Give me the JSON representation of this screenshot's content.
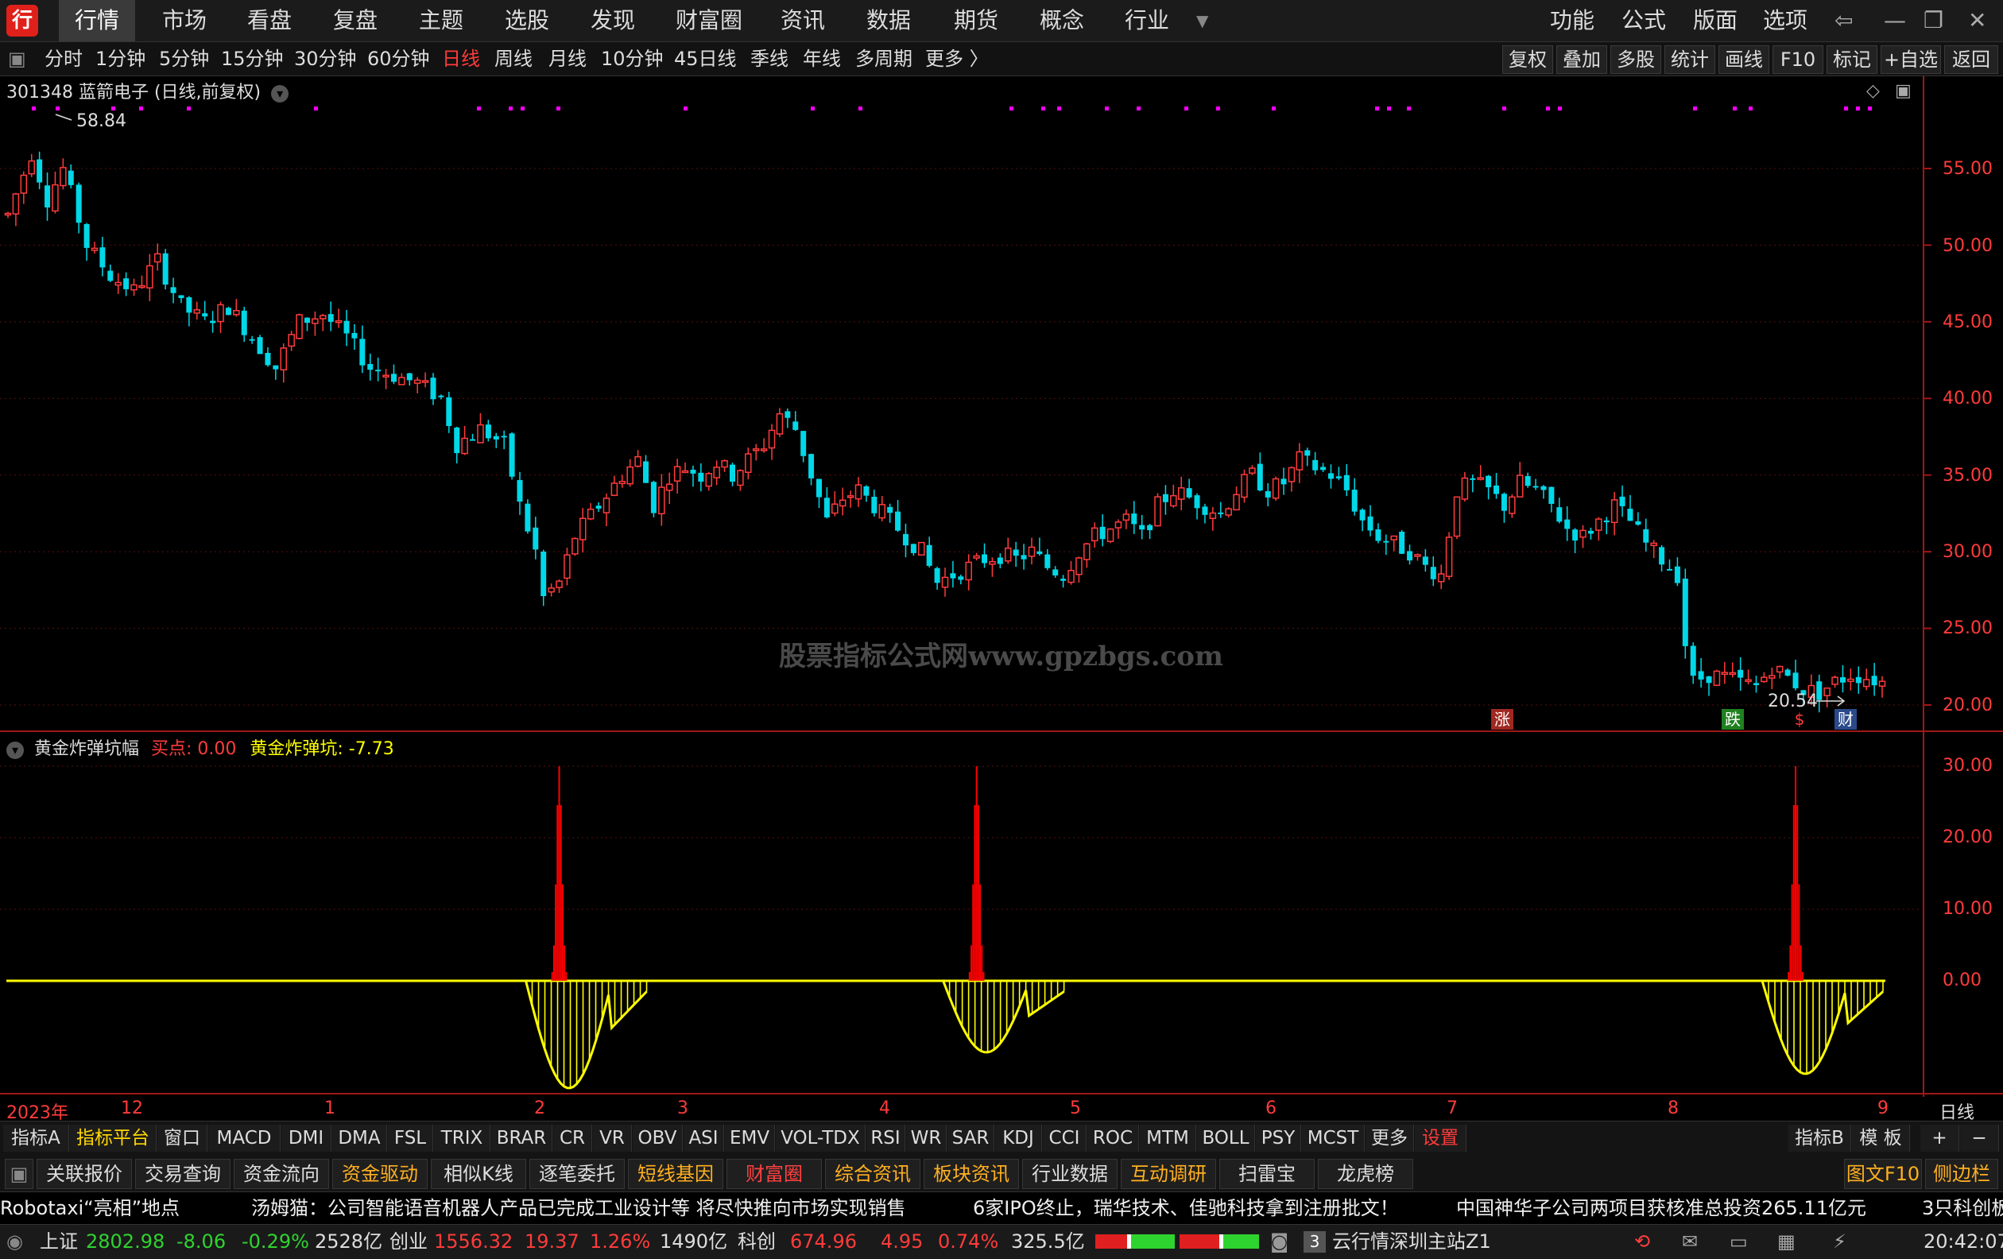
{
  "menu": {
    "logo_text": "行",
    "items": [
      "行情",
      "市场",
      "看盘",
      "复盘",
      "主题",
      "选股",
      "发现",
      "财富圈",
      "资讯",
      "数据",
      "期货",
      "概念",
      "行业"
    ],
    "more_icon": "chevron-down-icon",
    "right_items": [
      "功能",
      "公式",
      "版面",
      "选项"
    ]
  },
  "periods": {
    "items": [
      "分时",
      "1分钟",
      "5分钟",
      "15分钟",
      "30分钟",
      "60分钟",
      "日线",
      "周线",
      "月线",
      "10分钟",
      "45日线",
      "季线",
      "年线",
      "多周期",
      "更多 〉"
    ],
    "active": "日线",
    "right_buttons": [
      "复权",
      "叠加",
      "多股",
      "统计",
      "画线",
      "F10",
      "标记",
      "+自选",
      "返回"
    ]
  },
  "chart_title": "301348 蓝箭电子 (日线,前复权)",
  "price_high_label": "58.84",
  "price_low_label": "20.54",
  "watermark": "股票指标公式网www.gpzbgs.com",
  "event_markers": [
    {
      "text": "涨",
      "color": "#c0302a"
    },
    {
      "text": "跌",
      "color": "#2a8a2a"
    },
    {
      "text": "$",
      "color": "#c0302a"
    },
    {
      "text": "财",
      "color": "#3a5a9a"
    }
  ],
  "indicator": {
    "name": "黄金炸弹坑幅",
    "buy_label": "买点: 0.00",
    "pit_label": "黄金炸弹坑: -7.73"
  },
  "axis_label_period": "日线",
  "date_labels": [
    "2023年",
    "12",
    "1",
    "2",
    "3",
    "4",
    "5",
    "6",
    "7",
    "8",
    "9"
  ],
  "tabs": [
    "指标A",
    "指标平台",
    "窗口",
    "MACD",
    "DMI",
    "DMA",
    "FSL",
    "TRIX",
    "BRAR",
    "CR",
    "VR",
    "OBV",
    "ASI",
    "EMV",
    "VOL-TDX",
    "RSI",
    "WR",
    "SAR",
    "KDJ",
    "CCI",
    "ROC",
    "MTM",
    "BOLL",
    "PSY",
    "MCST",
    "更多",
    "设置"
  ],
  "tabs_right": [
    "指标B",
    "模 板",
    "+",
    "−"
  ],
  "func_buttons": [
    "关联报价",
    "交易查询",
    "资金流向",
    "资金驱动",
    "相似K线",
    "逐笔委托",
    "短线基因",
    "财富圈",
    "综合资讯",
    "板块资讯",
    "行业数据",
    "互动调研",
    "扫雷宝",
    "龙虎榜"
  ],
  "func_right": [
    "图文F10",
    "侧边栏"
  ],
  "news": [
    "Robotaxi“亮相”地点",
    "汤姆猫：公司智能语音机器人产品已完成工业设计等 将尽快推向市场实现销售",
    "6家IPO终止，瑞华技术、佳驰科技拿到注册批文！",
    "中国神华子公司两项目获核准总投资265.11亿元",
    "3只科创板"
  ],
  "status": {
    "sh_name": "上证",
    "sh_value": "2802.98",
    "sh_change": "-8.06",
    "sh_pct": "-0.29%",
    "sh_amount": "2528亿",
    "cy_name": "创业",
    "cy_value": "1556.32",
    "cy_change": "19.37",
    "cy_pct": "1.26%",
    "cy_amount": "1490亿",
    "kc_name": "科创",
    "kc_value": "674.96",
    "kc_change": "4.95",
    "kc_pct": "0.74%",
    "kc_amount": "325.5亿",
    "server": "云行情深圳主站Z1",
    "msg_count": "3",
    "time": "20:42:07"
  },
  "chart_data": {
    "type": "candlestick",
    "price_axis": {
      "min": 20.0,
      "max": 55.0,
      "ticks": [
        "55.00",
        "50.00",
        "45.00",
        "40.00",
        "35.00",
        "30.00",
        "25.00",
        "20.00"
      ]
    },
    "indicator_axis": {
      "ticks": [
        "30.00",
        "20.00",
        "10.00",
        "0.00"
      ]
    },
    "price_path": [
      [
        0,
        52
      ],
      [
        3,
        56
      ],
      [
        5,
        53
      ],
      [
        7,
        55
      ],
      [
        10,
        50
      ],
      [
        13,
        48
      ],
      [
        16,
        47
      ],
      [
        19,
        49
      ],
      [
        22,
        46
      ],
      [
        25,
        45
      ],
      [
        28,
        46
      ],
      [
        31,
        44
      ],
      [
        34,
        42
      ],
      [
        37,
        45
      ],
      [
        40,
        45.5
      ],
      [
        43,
        44
      ],
      [
        46,
        42
      ],
      [
        49,
        41.5
      ],
      [
        52,
        41
      ],
      [
        55,
        40
      ],
      [
        57,
        37
      ],
      [
        60,
        38
      ],
      [
        63,
        37
      ],
      [
        65,
        33
      ],
      [
        67,
        30
      ],
      [
        68,
        27
      ],
      [
        70,
        28
      ],
      [
        72,
        31
      ],
      [
        75,
        33
      ],
      [
        78,
        35
      ],
      [
        80,
        36
      ],
      [
        82,
        33
      ],
      [
        84,
        35
      ],
      [
        86,
        35.5
      ],
      [
        88,
        35
      ],
      [
        90,
        35.8
      ],
      [
        92,
        35
      ],
      [
        94,
        36
      ],
      [
        96,
        37
      ],
      [
        98,
        39
      ],
      [
        100,
        38
      ],
      [
        102,
        35
      ],
      [
        104,
        32
      ],
      [
        106,
        33.5
      ],
      [
        108,
        34
      ],
      [
        110,
        33
      ],
      [
        112,
        32
      ],
      [
        114,
        31
      ],
      [
        116,
        30
      ],
      [
        118,
        28
      ],
      [
        120,
        28.5
      ],
      [
        122,
        29
      ],
      [
        124,
        29.5
      ],
      [
        126,
        29.8
      ],
      [
        128,
        29.5
      ],
      [
        130,
        30
      ],
      [
        132,
        29
      ],
      [
        134,
        28.5
      ],
      [
        136,
        30
      ],
      [
        138,
        31
      ],
      [
        140,
        31.5
      ],
      [
        142,
        32
      ],
      [
        144,
        31
      ],
      [
        146,
        33
      ],
      [
        148,
        34
      ],
      [
        150,
        33.5
      ],
      [
        152,
        33
      ],
      [
        154,
        32.5
      ],
      [
        156,
        34
      ],
      [
        158,
        35
      ],
      [
        160,
        34
      ],
      [
        162,
        34.5
      ],
      [
        164,
        36
      ],
      [
        166,
        35.5
      ],
      [
        168,
        35
      ],
      [
        170,
        34
      ],
      [
        172,
        32
      ],
      [
        174,
        31
      ],
      [
        176,
        30.5
      ],
      [
        178,
        30
      ],
      [
        180,
        29
      ],
      [
        182,
        28.5
      ],
      [
        184,
        34
      ],
      [
        186,
        34.5
      ],
      [
        188,
        34
      ],
      [
        190,
        33
      ],
      [
        192,
        34.5
      ],
      [
        194,
        34
      ],
      [
        196,
        33
      ],
      [
        198,
        31.5
      ],
      [
        200,
        31
      ],
      [
        202,
        32
      ],
      [
        204,
        33
      ],
      [
        206,
        32
      ],
      [
        208,
        30.5
      ],
      [
        210,
        29.5
      ],
      [
        212,
        28.5
      ],
      [
        213,
        24
      ],
      [
        214,
        21.5
      ],
      [
        216,
        22
      ],
      [
        218,
        21.8
      ],
      [
        220,
        21.5
      ],
      [
        222,
        21.2
      ],
      [
        224,
        22.5
      ],
      [
        226,
        21.8
      ],
      [
        228,
        21
      ],
      [
        230,
        20.8
      ],
      [
        232,
        21.5
      ],
      [
        234,
        22
      ],
      [
        236,
        21.8
      ],
      [
        238,
        21.5
      ]
    ],
    "pit_events": [
      {
        "bar": 70,
        "peak": 30,
        "depth": -15
      },
      {
        "bar": 123,
        "peak": 30,
        "depth": -10
      },
      {
        "bar": 227,
        "peak": 30,
        "depth": -13
      }
    ],
    "colors": {
      "up": "#ff3b3b",
      "down": "#00d8e8",
      "pit": "#ffff00",
      "buy": "#ff0000",
      "dot": "#ff00ff"
    }
  }
}
